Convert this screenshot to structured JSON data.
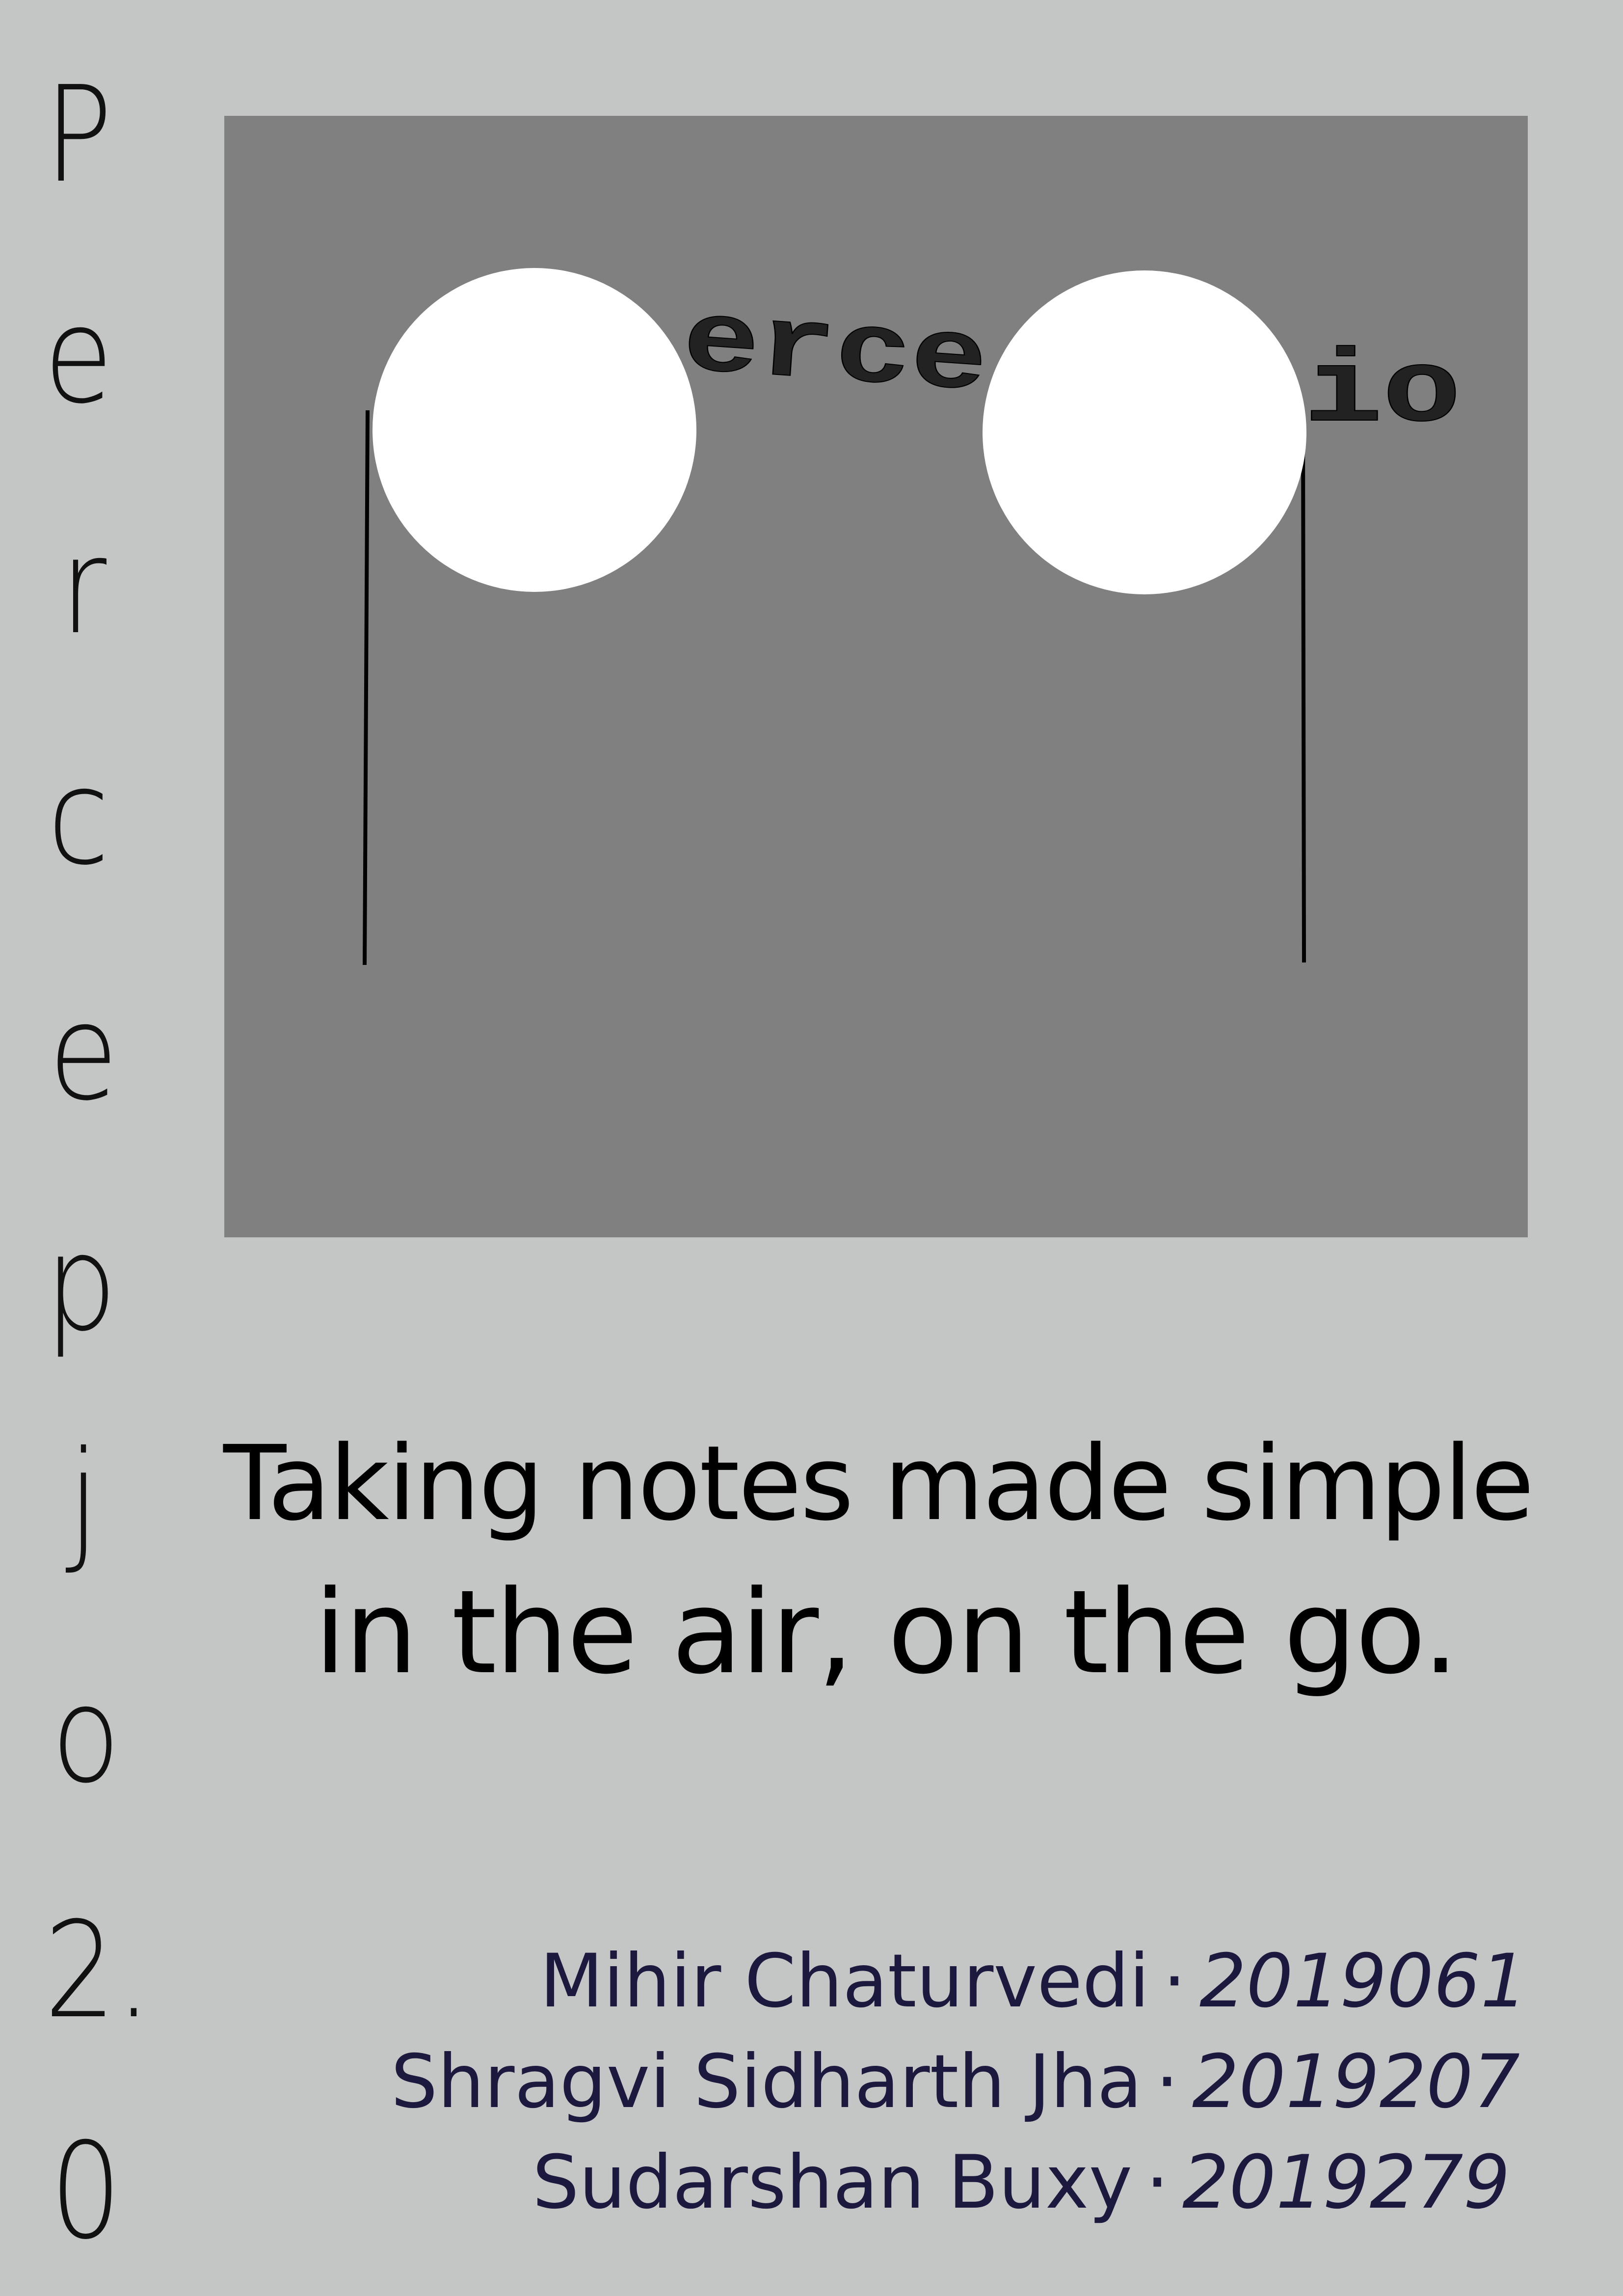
{
  "vertical_title": [
    "P",
    "e",
    "r",
    "c",
    "e",
    "p",
    "j",
    "o",
    "2.",
    "0"
  ],
  "hero": {
    "word_left": "erce",
    "word_right": "io",
    "colors": {
      "panel": "#808080",
      "circle": "#ffffff",
      "line": "#000000"
    }
  },
  "tagline": {
    "line1": "Taking notes made simple",
    "line2": "in the air, on the go."
  },
  "credits": [
    {
      "name": "Mihir Chaturvedi",
      "separator": "·",
      "id": "2019061"
    },
    {
      "name": "Shragvi Sidharth Jha",
      "separator": "·",
      "id": "2019207"
    },
    {
      "name": "Sudarshan Buxy",
      "separator": "·",
      "id": "2019279"
    }
  ],
  "colors": {
    "background": "#c4c5c5",
    "credit_text": "#1b1a3e"
  }
}
